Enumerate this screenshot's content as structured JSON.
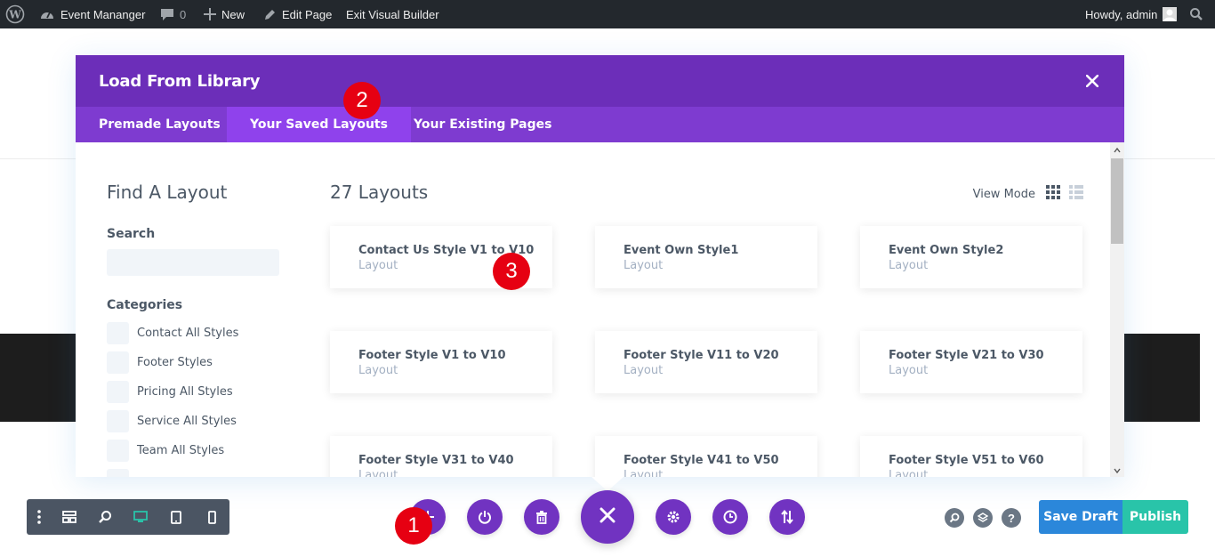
{
  "admin_bar": {
    "site_name": "Event Mananger",
    "comments_count": "0",
    "new_label": "New",
    "edit_page_label": "Edit Page",
    "exit_label": "Exit Visual Builder",
    "howdy": "Howdy, admin"
  },
  "modal": {
    "title": "Load From Library",
    "tabs": [
      {
        "label": "Premade Layouts",
        "active": false
      },
      {
        "label": "Your Saved Layouts",
        "active": true
      },
      {
        "label": "Your Existing Pages",
        "active": false
      }
    ],
    "sidebar": {
      "find_title": "Find A Layout",
      "search_label": "Search",
      "search_value": "",
      "categories_label": "Categories",
      "categories": [
        "Contact All Styles",
        "Footer Styles",
        "Pricing All Styles",
        "Service All Styles",
        "Team All Styles"
      ]
    },
    "layouts_count_title": "27 Layouts",
    "view_mode_label": "View Mode",
    "layouts": [
      {
        "name": "Contact Us Style V1 to V10",
        "type": "Layout"
      },
      {
        "name": "Event Own Style1",
        "type": "Layout"
      },
      {
        "name": "Event Own Style2",
        "type": "Layout"
      },
      {
        "name": "Footer Style V1 to V10",
        "type": "Layout"
      },
      {
        "name": "Footer Style V11 to V20",
        "type": "Layout"
      },
      {
        "name": "Footer Style V21 to V30",
        "type": "Layout"
      },
      {
        "name": "Footer Style V31 to V40",
        "type": "Layout"
      },
      {
        "name": "Footer Style V41 to V50",
        "type": "Layout"
      },
      {
        "name": "Footer Style V51 to V60",
        "type": "Layout"
      }
    ]
  },
  "bottom_bar": {
    "save_draft": "Save Draft",
    "publish": "Publish",
    "help_glyph": "?"
  },
  "markers": [
    "1",
    "2",
    "3"
  ],
  "colors": {
    "modal_header": "#6c2eb9",
    "tabs_bar": "#7e3bd0",
    "active_tab": "#8f42ec",
    "circle_buttons": "#7133c1",
    "save_draft": "#2b87da",
    "publish": "#29c4a9",
    "marker": "#e60012"
  },
  "icons": [
    "wordpress-icon",
    "dashboard-icon",
    "comment-icon",
    "plus-icon",
    "pencil-icon",
    "user-avatar",
    "search-icon",
    "close-icon",
    "grid-view-icon",
    "list-view-icon",
    "more-icon",
    "wireframe-icon",
    "zoom-icon",
    "desktop-icon",
    "tablet-icon",
    "phone-icon",
    "add-icon",
    "power-icon",
    "trash-icon",
    "gear-icon",
    "history-icon",
    "sort-icon",
    "layers-icon",
    "help-icon"
  ]
}
